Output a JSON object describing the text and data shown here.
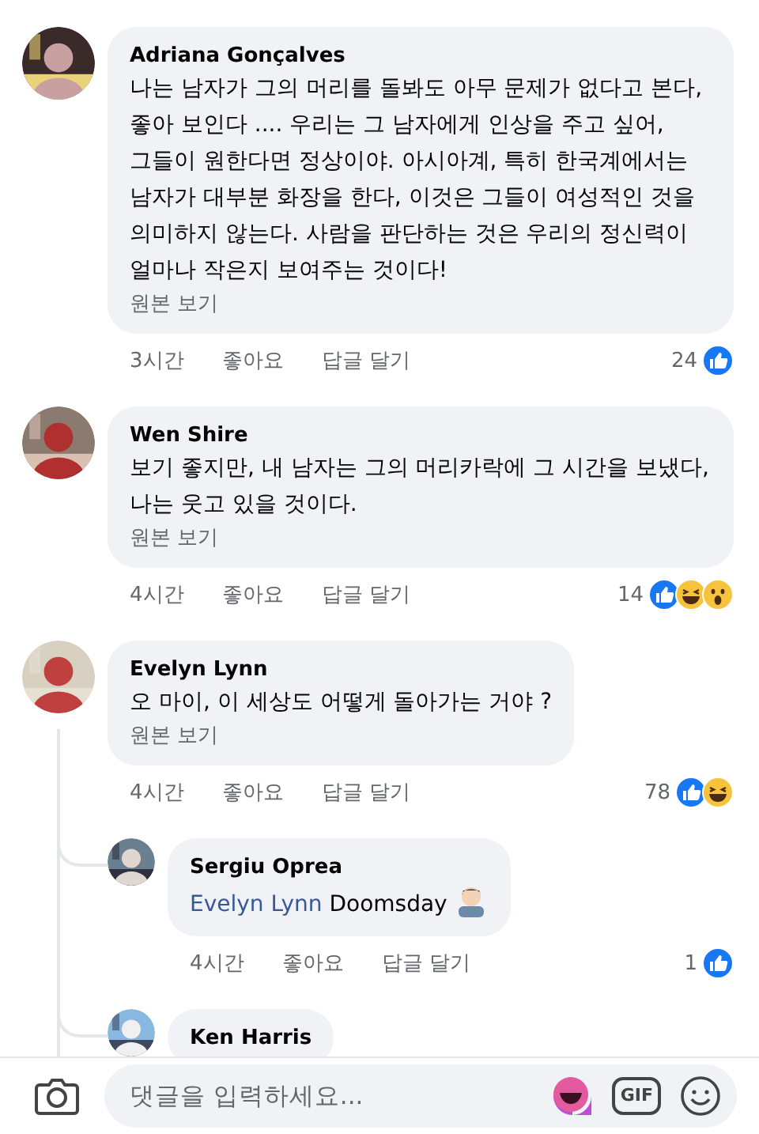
{
  "comments": [
    {
      "author": "Adriana Gonçalves",
      "text": "나는 남자가 그의 머리를 돌봐도 아무 문제가 없다고 본다, 좋아 보인다 .... 우리는 그 남자에게 인상을 주고 싶어, 그들이 원한다면 정상이야. 아시아계, 특히 한국계에서는 남자가 대부분 화장을 한다, 이것은 그들이 여성적인 것을 의미하지 않는다. 사람을 판단하는 것은 우리의 정신력이 얼마나 작은지 보여주는 것이다!",
      "see_original": "원본 보기",
      "time": "3시간",
      "like": "좋아요",
      "reply": "답글 달기",
      "reaction_count": "24",
      "reactions": [
        {
          "kind": "like"
        }
      ]
    },
    {
      "author": "Wen Shire",
      "text": "보기 좋지만, 내 남자는 그의 머리카락에 그 시간을 보냈다, 나는 웃고 있을 것이다.",
      "see_original": "원본 보기",
      "time": "4시간",
      "like": "좋아요",
      "reply": "답글 달기",
      "reaction_count": "14",
      "reactions": [
        {
          "kind": "like"
        },
        {
          "kind": "haha"
        },
        {
          "kind": "wow"
        }
      ]
    },
    {
      "author": "Evelyn Lynn",
      "text": "오 마이, 이 세상도 어떻게 돌아가는 거야 ?",
      "see_original": "원본 보기",
      "time": "4시간",
      "like": "좋아요",
      "reply": "답글 달기",
      "reaction_count": "78",
      "reactions": [
        {
          "kind": "like"
        },
        {
          "kind": "haha"
        }
      ],
      "replies": [
        {
          "author": "Sergiu Oprea",
          "mention": "Evelyn Lynn",
          "text": "Doomsday",
          "time": "4시간",
          "like": "좋아요",
          "reply": "답글 달기",
          "reaction_count": "1",
          "reactions": [
            {
              "kind": "like"
            }
          ]
        },
        {
          "author": "Ken Harris"
        }
      ]
    }
  ],
  "composer": {
    "placeholder": "댓글을 입력하세요...",
    "gif": "GIF"
  }
}
